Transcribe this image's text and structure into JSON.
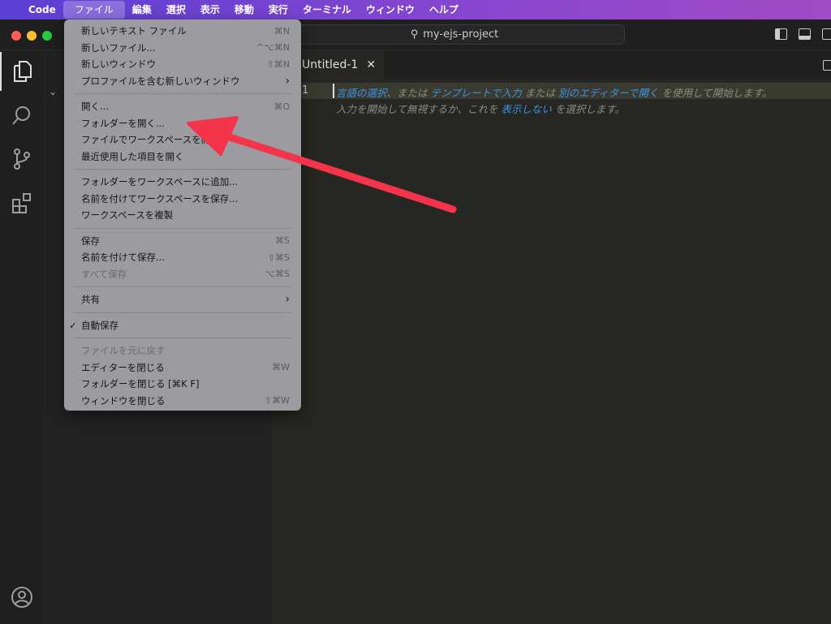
{
  "menubar": {
    "app": "Code",
    "items": [
      "ファイル",
      "編集",
      "選択",
      "表示",
      "移動",
      "実行",
      "ターミナル",
      "ウィンドウ",
      "ヘルプ"
    ]
  },
  "titlebar": {
    "search": "my-ejs-project"
  },
  "tab": {
    "title": "Untitled-1"
  },
  "editor": {
    "line_number": "1",
    "hint1": [
      {
        "t": "言語の選択",
        "link": true
      },
      {
        "t": "、または ",
        "link": false
      },
      {
        "t": "テンプレートで入力",
        "link": true
      },
      {
        "t": " または ",
        "link": false
      },
      {
        "t": "別のエディターで開く",
        "link": true
      },
      {
        "t": " を使用して開始します。",
        "link": false
      }
    ],
    "hint2": [
      {
        "t": "入力を開始して無視するか、これを ",
        "link": false
      },
      {
        "t": "表示しない",
        "link": true
      },
      {
        "t": " を選択します。",
        "link": false
      }
    ]
  },
  "file_menu": {
    "groups": [
      [
        {
          "label": "新しいテキスト ファイル",
          "shortcut": "⌘N"
        },
        {
          "label": "新しいファイル...",
          "shortcut": "^⌥⌘N"
        },
        {
          "label": "新しいウィンドウ",
          "shortcut": "⇧⌘N"
        },
        {
          "label": "プロファイルを含む新しいウィンドウ",
          "shortcut": "›"
        }
      ],
      [
        {
          "label": "開く...",
          "shortcut": "⌘O"
        },
        {
          "label": "フォルダーを開く...",
          "shortcut": ""
        },
        {
          "label": "ファイルでワークスペースを開く...",
          "shortcut": ""
        },
        {
          "label": "最近使用した項目を開く",
          "shortcut": ""
        }
      ],
      [
        {
          "label": "フォルダーをワークスペースに追加...",
          "shortcut": ""
        },
        {
          "label": "名前を付けてワークスペースを保存...",
          "shortcut": ""
        },
        {
          "label": "ワークスペースを複製",
          "shortcut": ""
        }
      ],
      [
        {
          "label": "保存",
          "shortcut": "⌘S"
        },
        {
          "label": "名前を付けて保存...",
          "shortcut": "⇧⌘S"
        },
        {
          "label": "すべて保存",
          "shortcut": "⌥⌘S",
          "disabled": true
        }
      ],
      [
        {
          "label": "共有",
          "shortcut": "›"
        }
      ],
      [
        {
          "label": "自動保存",
          "shortcut": "",
          "checked": true
        }
      ],
      [
        {
          "label": "ファイルを元に戻す",
          "shortcut": "",
          "disabled": true
        },
        {
          "label": "エディターを閉じる",
          "shortcut": "⌘W"
        },
        {
          "label": "フォルダーを閉じる [⌘K F]",
          "shortcut": ""
        },
        {
          "label": "ウィンドウを閉じる",
          "shortcut": "⇧⌘W"
        }
      ]
    ]
  },
  "colors": {
    "annotation_arrow": "#f4344a",
    "link": "#3b94e6",
    "menubar": "#7a44d0"
  }
}
